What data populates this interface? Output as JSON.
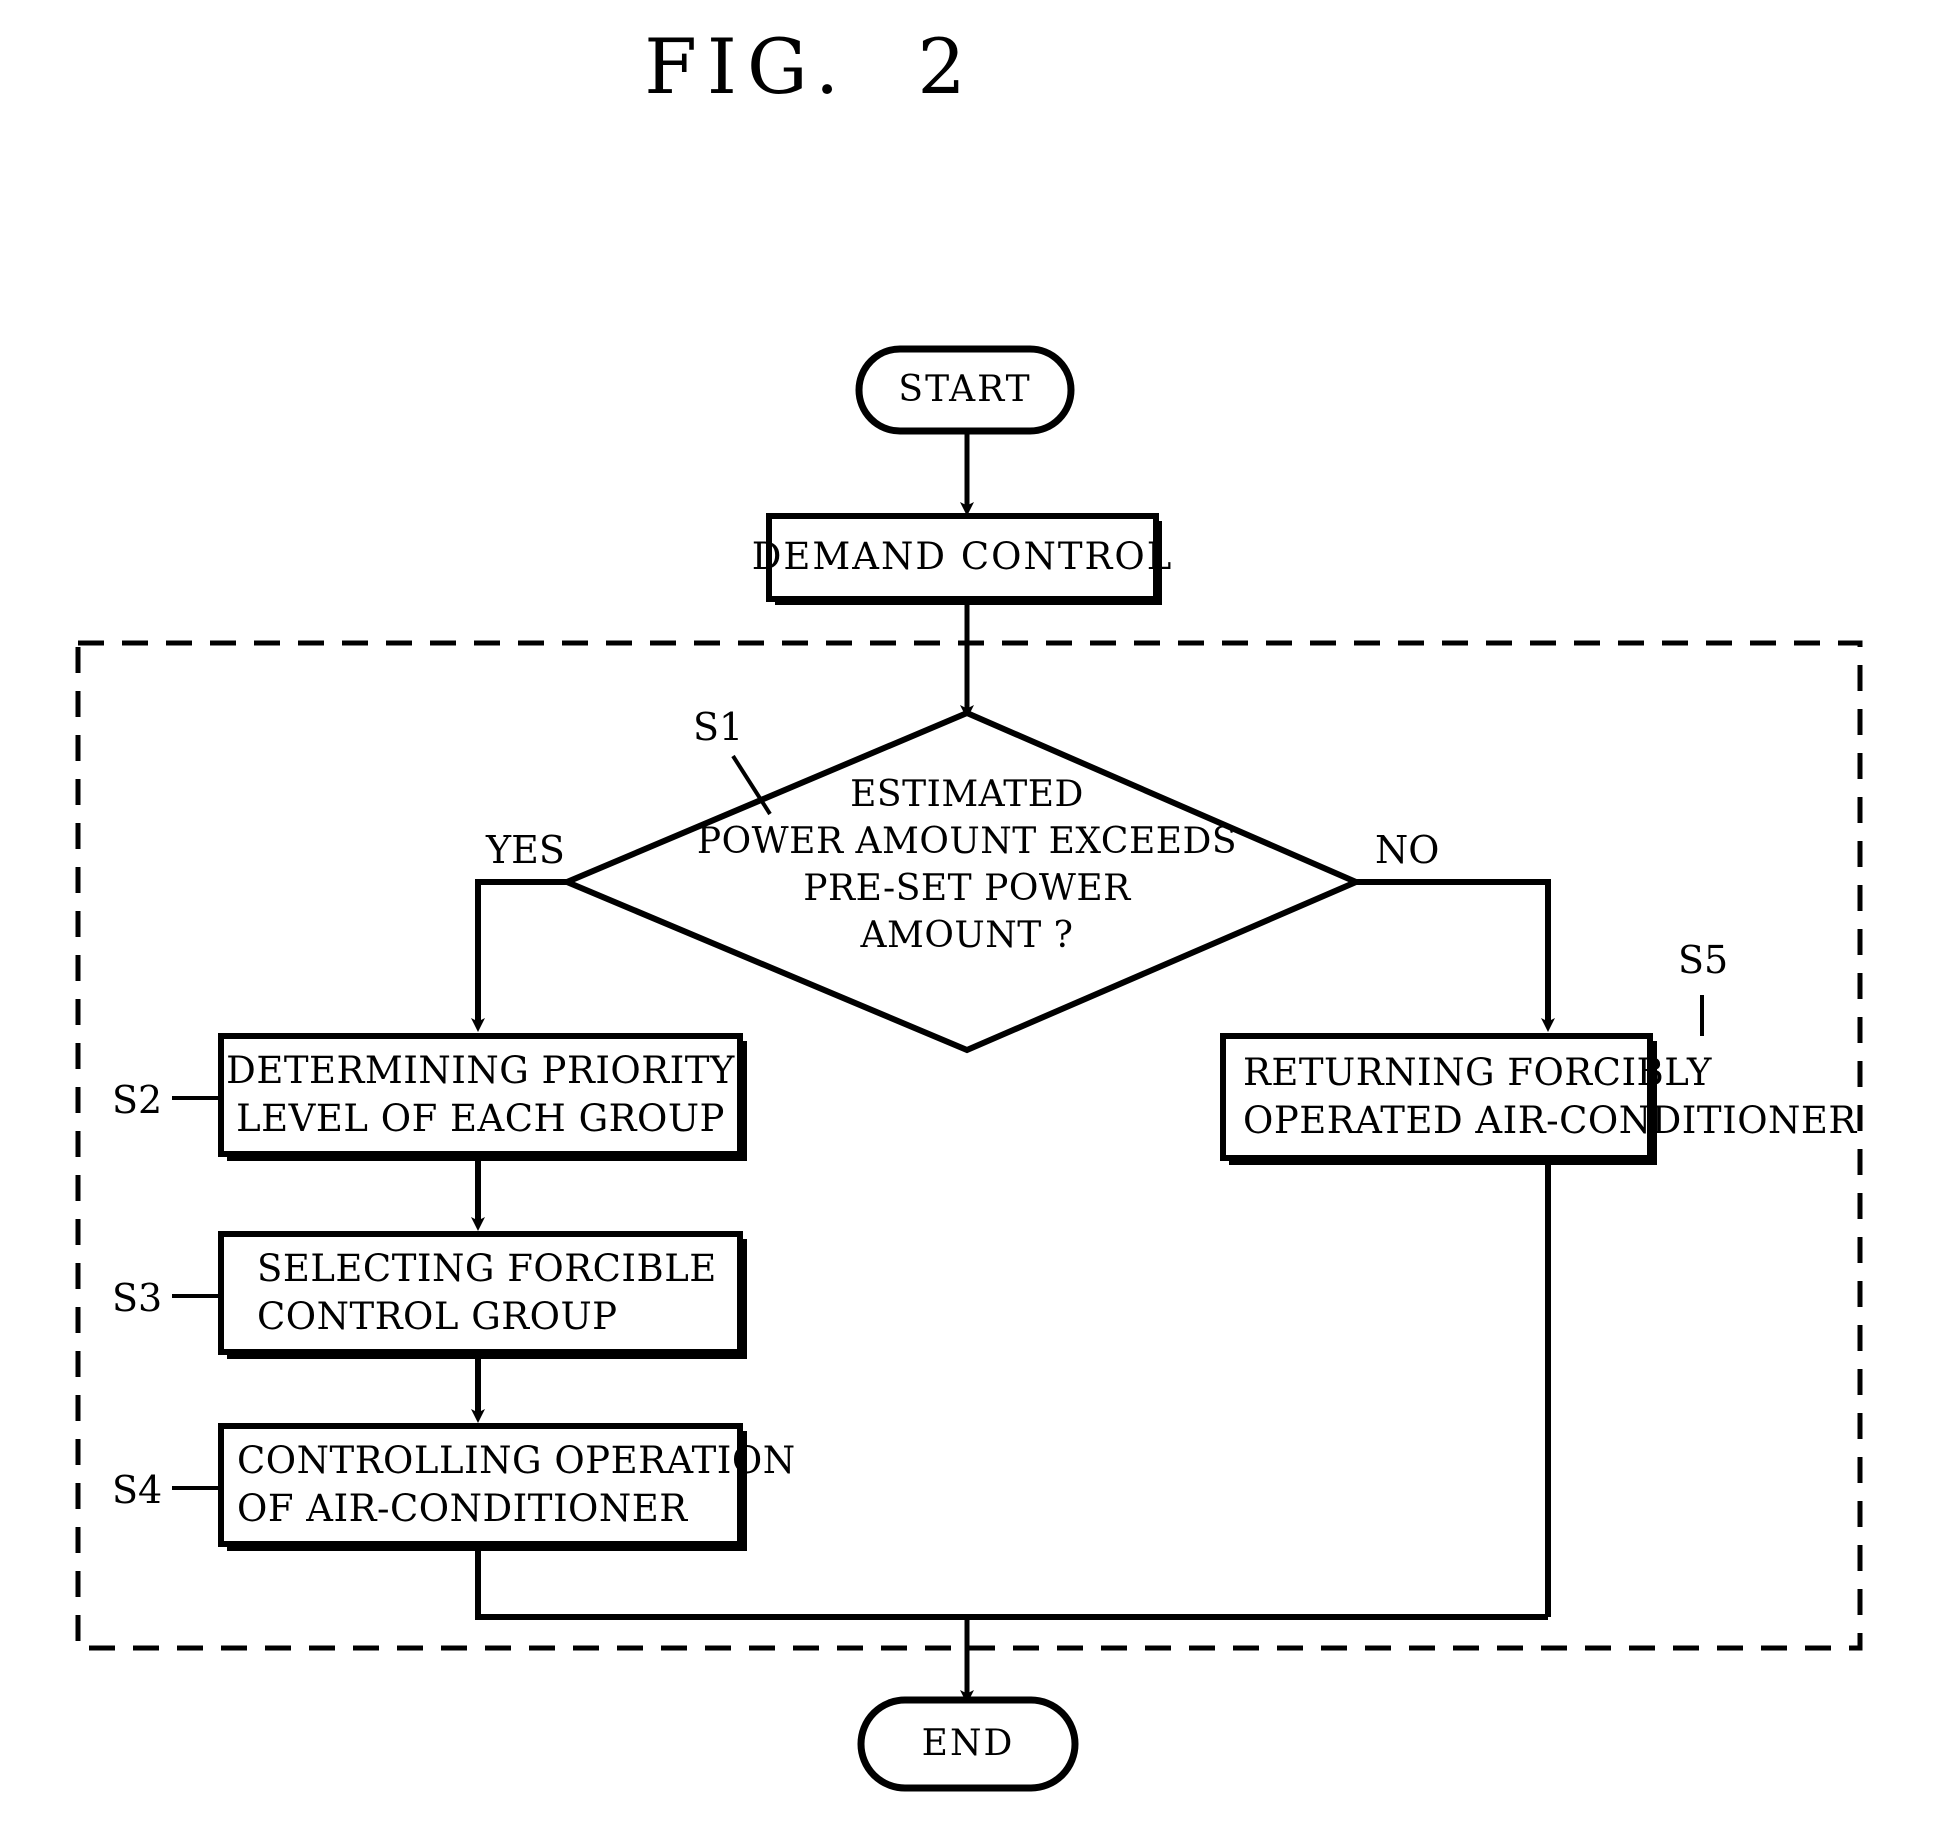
{
  "figure": {
    "title": "FIG.  2",
    "type": "flowchart",
    "description": "Patent flowchart for demand control of air-conditioner groups"
  },
  "nodes": {
    "start": {
      "label": "START",
      "shape": "terminator"
    },
    "demand_control": {
      "label": "DEMAND CONTROL",
      "shape": "process"
    },
    "decision": {
      "ref": "S1",
      "shape": "decision",
      "lines": [
        "ESTIMATED",
        "POWER AMOUNT EXCEEDS",
        "PRE-SET POWER",
        "AMOUNT ?"
      ],
      "yes_label": "YES",
      "no_label": "NO"
    },
    "s2": {
      "ref": "S2",
      "shape": "process",
      "lines": [
        "DETERMINING PRIORITY",
        "LEVEL OF EACH GROUP"
      ]
    },
    "s3": {
      "ref": "S3",
      "shape": "process",
      "lines": [
        "SELECTING FORCIBLE",
        "CONTROL GROUP"
      ]
    },
    "s4": {
      "ref": "S4",
      "shape": "process",
      "lines": [
        "CONTROLLING OPERATION",
        "OF AIR-CONDITIONER"
      ]
    },
    "s5": {
      "ref": "S5",
      "shape": "process",
      "lines": [
        "RETURNING FORCIBLY",
        "OPERATED AIR-CONDITIONER"
      ]
    },
    "end": {
      "label": "END",
      "shape": "terminator"
    }
  },
  "colors": {
    "line": "#000000",
    "text": "#000000",
    "background": "#ffffff"
  },
  "chart_data": {
    "type": "diagram",
    "title": "FIG.  2",
    "steps": [
      {
        "id": "start",
        "ref": "",
        "text": "START",
        "shape": "terminator"
      },
      {
        "id": "demand_control",
        "ref": "",
        "text": "DEMAND CONTROL",
        "shape": "process"
      },
      {
        "id": "s1",
        "ref": "S1",
        "text": "ESTIMATED POWER AMOUNT EXCEEDS PRE-SET POWER AMOUNT ?",
        "shape": "decision"
      },
      {
        "id": "s2",
        "ref": "S2",
        "text": "DETERMINING PRIORITY LEVEL OF EACH GROUP",
        "shape": "process"
      },
      {
        "id": "s3",
        "ref": "S3",
        "text": "SELECTING FORCIBLE CONTROL GROUP",
        "shape": "process"
      },
      {
        "id": "s4",
        "ref": "S4",
        "text": "CONTROLLING OPERATION OF AIR-CONDITIONER",
        "shape": "process"
      },
      {
        "id": "s5",
        "ref": "S5",
        "text": "RETURNING FORCIBLY OPERATED AIR-CONDITIONER",
        "shape": "process"
      },
      {
        "id": "end",
        "ref": "",
        "text": "END",
        "shape": "terminator"
      }
    ],
    "edges": [
      {
        "from": "start",
        "to": "demand_control",
        "label": ""
      },
      {
        "from": "demand_control",
        "to": "s1",
        "label": ""
      },
      {
        "from": "s1",
        "to": "s2",
        "label": "YES"
      },
      {
        "from": "s1",
        "to": "s5",
        "label": "NO"
      },
      {
        "from": "s2",
        "to": "s3",
        "label": ""
      },
      {
        "from": "s3",
        "to": "s4",
        "label": ""
      },
      {
        "from": "s4",
        "to": "end",
        "label": ""
      },
      {
        "from": "s5",
        "to": "end",
        "label": ""
      }
    ]
  }
}
